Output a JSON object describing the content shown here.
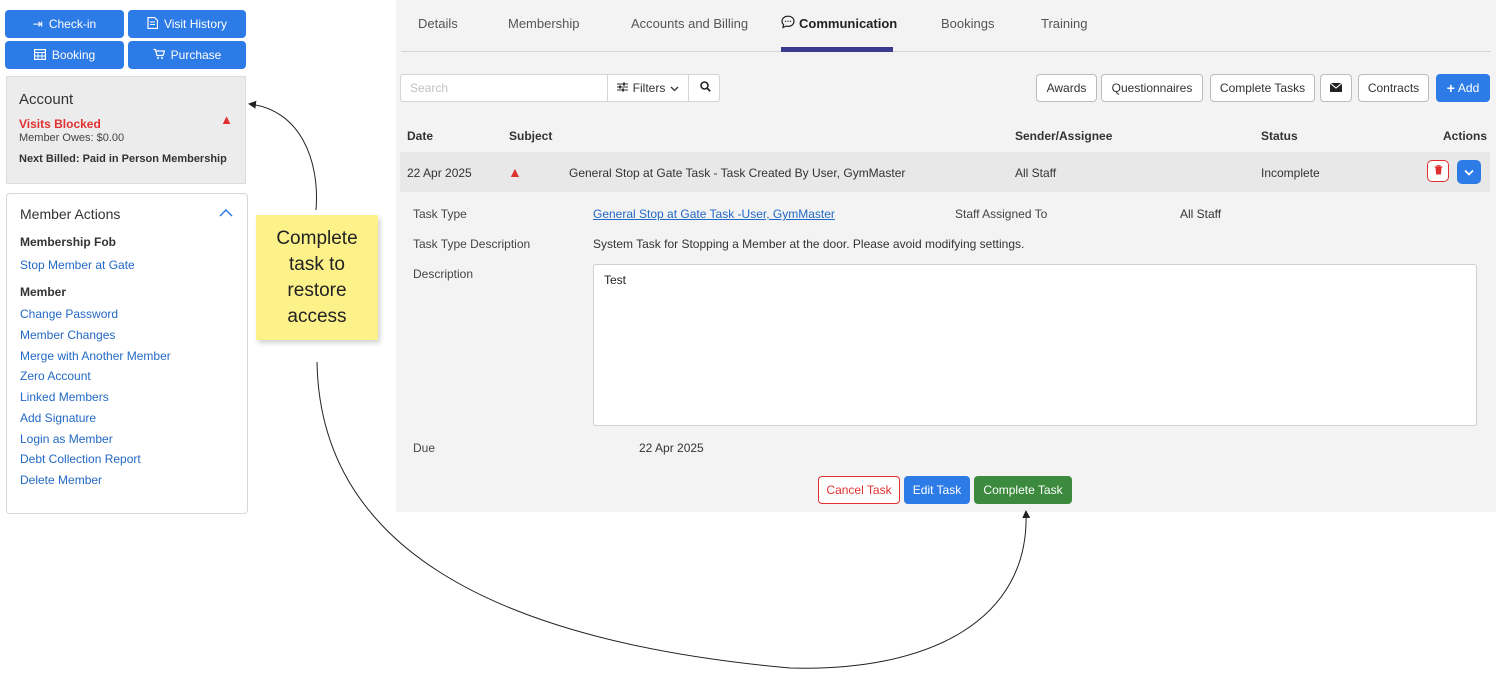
{
  "top_buttons": {
    "checkin": "Check-in",
    "visit_history": "Visit History",
    "booking": "Booking",
    "purchase": "Purchase"
  },
  "account": {
    "title": "Account",
    "status": "Visits Blocked",
    "owes": "Member Owes: $0.00",
    "next_billed": "Next Billed: Paid in Person Membership"
  },
  "member_actions": {
    "title": "Member Actions",
    "sections": [
      {
        "heading": "Membership Fob",
        "items": [
          "Stop Member at Gate"
        ]
      },
      {
        "heading": "Member",
        "items": [
          "Change Password",
          "Member Changes",
          "Merge with Another Member",
          "Zero Account",
          "Linked Members",
          "Add Signature",
          "Login as Member",
          "Debt Collection Report",
          "Delete Member"
        ]
      }
    ]
  },
  "sticky_note": "Complete task to restore access",
  "tabs": [
    "Details",
    "Membership",
    "Accounts and Billing",
    "Communication",
    "Bookings",
    "Training"
  ],
  "active_tab": "Communication",
  "search": {
    "placeholder": "Search",
    "filters_label": "Filters"
  },
  "toolbar": {
    "awards": "Awards",
    "questionnaires": "Questionnaires",
    "complete_tasks": "Complete Tasks",
    "contracts": "Contracts",
    "add": "Add"
  },
  "table": {
    "headers": {
      "date": "Date",
      "subject": "Subject",
      "sender": "Sender/Assignee",
      "status": "Status",
      "actions": "Actions"
    },
    "row": {
      "date": "22 Apr 2025",
      "subject": "General Stop at Gate Task - Task Created By User, GymMaster",
      "sender": "All Staff",
      "status": "Incomplete"
    }
  },
  "detail": {
    "task_type_label": "Task Type",
    "task_type_value": "General Stop at Gate Task -User, GymMaster",
    "staff_assigned_label": "Staff Assigned To",
    "staff_assigned_value": "All Staff",
    "type_desc_label": "Task Type Description",
    "type_desc_value": "System Task for Stopping a Member at the door. Please avoid modifying settings.",
    "description_label": "Description",
    "description_value": "Test",
    "due_label": "Due",
    "due_value": "22 Apr 2025"
  },
  "footer_buttons": {
    "cancel": "Cancel Task",
    "edit": "Edit Task",
    "complete": "Complete Task"
  },
  "colors": {
    "primary": "#2d7be6",
    "danger": "#e03131",
    "success": "#3b8a3e",
    "sticky": "#fdf28a",
    "tab_accent": "#3b3a8c"
  }
}
